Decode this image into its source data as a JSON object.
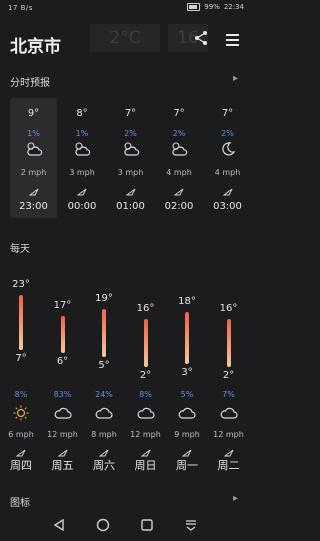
{
  "status": {
    "left": "17 B/s",
    "battery": "99%",
    "time": "22:34"
  },
  "header": {
    "city": "北京市",
    "ghost_temp": "2°C",
    "ghost_time": "16"
  },
  "hourly": {
    "title": "分时预报",
    "items": [
      {
        "temp": "9°",
        "pct": "1%",
        "icon": "partly-cloudy-icon",
        "wind": "2 mph",
        "time": "23:00"
      },
      {
        "temp": "8°",
        "pct": "1%",
        "icon": "partly-cloudy-icon",
        "wind": "3 mph",
        "time": "00:00"
      },
      {
        "temp": "7°",
        "pct": "2%",
        "icon": "partly-cloudy-icon",
        "wind": "3 mph",
        "time": "01:00"
      },
      {
        "temp": "7°",
        "pct": "2%",
        "icon": "partly-cloudy-icon",
        "wind": "4 mph",
        "time": "02:00"
      },
      {
        "temp": "7°",
        "pct": "2%",
        "icon": "moon-icon",
        "wind": "4 mph",
        "time": "03:00"
      }
    ]
  },
  "daily": {
    "title": "每天",
    "items": [
      {
        "hi": "23°",
        "lo": "7°",
        "hi_value": 23,
        "lo_value": 7,
        "pct": "8%",
        "icon": "sun-icon",
        "wind": "6 mph",
        "day": "周四"
      },
      {
        "hi": "17°",
        "lo": "6°",
        "hi_value": 17,
        "lo_value": 6,
        "pct": "83%",
        "icon": "cloud-icon",
        "wind": "12 mph",
        "day": "周五"
      },
      {
        "hi": "19°",
        "lo": "5°",
        "hi_value": 19,
        "lo_value": 5,
        "pct": "24%",
        "icon": "cloud-icon",
        "wind": "8 mph",
        "day": "周六"
      },
      {
        "hi": "16°",
        "lo": "2°",
        "hi_value": 16,
        "lo_value": 2,
        "pct": "8%",
        "icon": "cloud-icon",
        "wind": "12 mph",
        "day": "周日"
      },
      {
        "hi": "18°",
        "lo": "3°",
        "hi_value": 18,
        "lo_value": 3,
        "pct": "5%",
        "icon": "cloud-icon",
        "wind": "9 mph",
        "day": "周一"
      },
      {
        "hi": "16°",
        "lo": "2°",
        "hi_value": 16,
        "lo_value": 2,
        "pct": "7%",
        "icon": "cloud-icon",
        "wind": "12 mph",
        "day": "周二"
      }
    ]
  },
  "charts": {
    "title": "图标"
  },
  "colors": {
    "background": "#1c1c1e",
    "precip": "#5f8fd6",
    "bar_top": "#f06046",
    "bar_bottom": "#f3c99c"
  }
}
